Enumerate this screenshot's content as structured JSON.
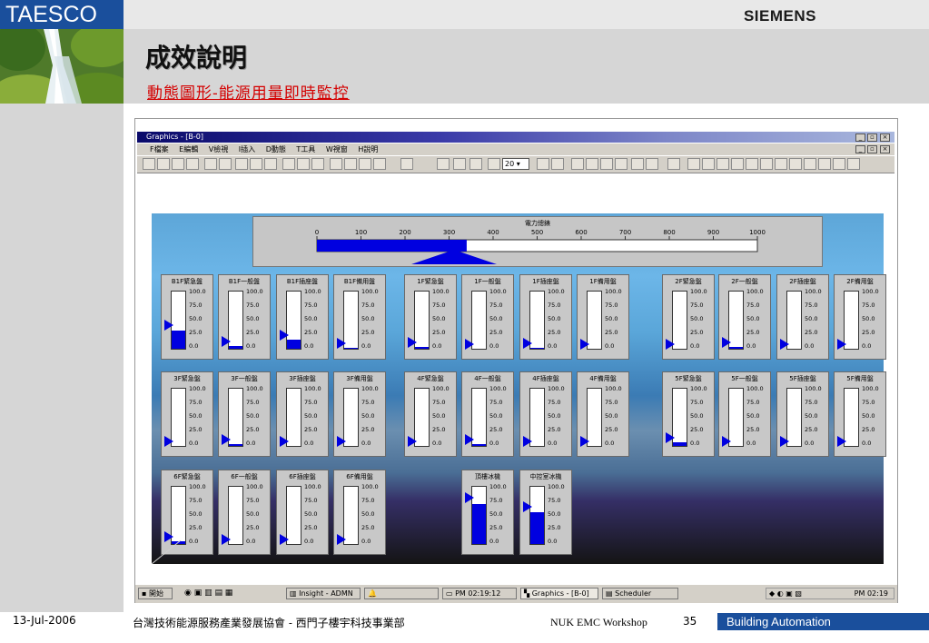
{
  "slide": {
    "brand": "TAESCO",
    "logo": "SIEMENS",
    "title": "成效說明",
    "subtitle": "動態圖形-能源用量即時監控",
    "footer_date": "13-Jul-2006",
    "footer_org": "台灣技術能源服務產業發展協會 - 西門子樓宇科技事業部",
    "footer_event": "NUK EMC Workshop",
    "page_number": "35",
    "footer_tag": "Building Automation"
  },
  "window": {
    "title": "Graphics - [B-0]",
    "menu": [
      "F檔案",
      "E編輯",
      "V檢視",
      "I插入",
      "D動態",
      "T工具",
      "W視窗",
      "H說明"
    ],
    "zoom_value": "20"
  },
  "meter": {
    "label": "電力總錶",
    "ticks": [
      "0",
      "100",
      "200",
      "300",
      "400",
      "500",
      "600",
      "700",
      "800",
      "900",
      "1000"
    ],
    "value": 340,
    "max": 1000
  },
  "gauge_ticks": [
    "100.0",
    "75.0",
    "50.0",
    "25.0",
    "0.0"
  ],
  "gauge_rows": [
    [
      {
        "label": "B1F緊急盤",
        "value": 0.32
      },
      {
        "label": "B1F一般盤",
        "value": 0.04
      },
      {
        "label": "B1F插座盤",
        "value": 0.16
      },
      {
        "label": "B1F備用盤",
        "value": 0.02
      },
      {
        "label": "1F緊急盤",
        "value": 0.03
      },
      {
        "label": "1F一般盤",
        "value": 0.0
      },
      {
        "label": "1F插座盤",
        "value": 0.02
      },
      {
        "label": "1F備用盤",
        "value": 0.0
      },
      {
        "label": "2F緊急盤",
        "value": 0.0
      },
      {
        "label": "2F一般盤",
        "value": 0.03
      },
      {
        "label": "2F插座盤",
        "value": 0.0
      },
      {
        "label": "2F備用盤",
        "value": 0.0
      }
    ],
    [
      {
        "label": "3F緊急盤",
        "value": 0.0
      },
      {
        "label": "3F一般盤",
        "value": 0.03
      },
      {
        "label": "3F插座盤",
        "value": 0.0
      },
      {
        "label": "3F備用盤",
        "value": 0.0
      },
      {
        "label": "4F緊急盤",
        "value": 0.0
      },
      {
        "label": "4F一般盤",
        "value": 0.03
      },
      {
        "label": "4F插座盤",
        "value": 0.0
      },
      {
        "label": "4F備用盤",
        "value": 0.0
      },
      {
        "label": "5F緊急盤",
        "value": 0.06
      },
      {
        "label": "5F一般盤",
        "value": 0.0
      },
      {
        "label": "5F插座盤",
        "value": 0.0
      },
      {
        "label": "5F備用盤",
        "value": 0.0
      }
    ],
    [
      {
        "label": "6F緊急盤",
        "value": 0.05
      },
      {
        "label": "6F一般盤",
        "value": 0.0
      },
      {
        "label": "6F插座盤",
        "value": 0.0
      },
      {
        "label": "6F備用盤",
        "value": 0.0
      },
      {
        "label": "頂樓冰機",
        "value": 0.7
      },
      {
        "label": "中控室冰機",
        "value": 0.55
      }
    ]
  ],
  "taskbar": {
    "start": "開始",
    "items": [
      "Insight - ADMN",
      "PM 02:19:12",
      "Graphics - [B-0]",
      "Scheduler"
    ],
    "clock": "PM 02:19"
  }
}
